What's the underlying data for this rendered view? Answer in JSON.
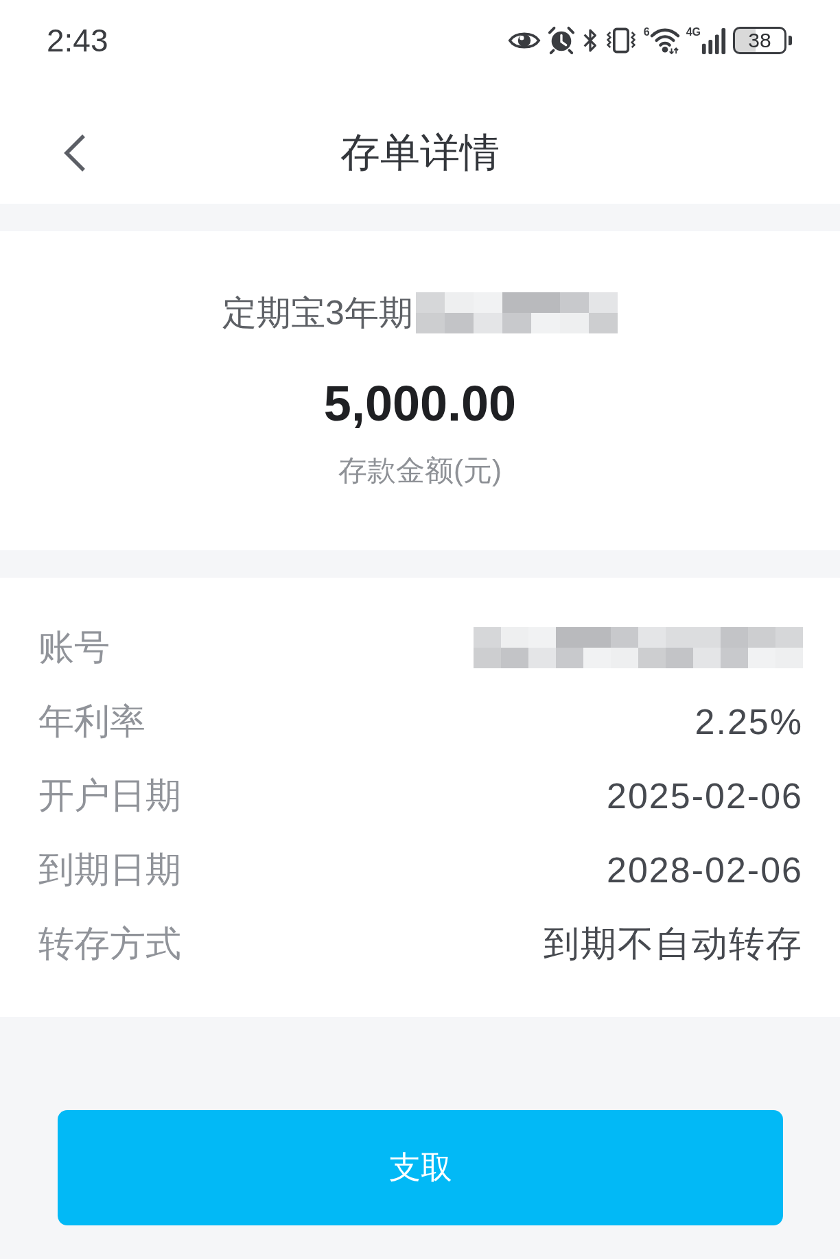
{
  "status_bar": {
    "time": "2:43",
    "wifi_generation": "6",
    "network_type": "4G",
    "battery": "38"
  },
  "header": {
    "title": "存单详情"
  },
  "summary": {
    "product_name": "定期宝3年期",
    "name_masked": true,
    "amount": "5,000.00",
    "amount_label": "存款金额(元)"
  },
  "details": [
    {
      "label": "账号",
      "kind": "masked"
    },
    {
      "label": "年利率",
      "kind": "text",
      "value": "2.25%"
    },
    {
      "label": "开户日期",
      "kind": "text",
      "value": "2025-02-06"
    },
    {
      "label": "到期日期",
      "kind": "text",
      "value": "2028-02-06"
    },
    {
      "label": "转存方式",
      "kind": "text",
      "value": "到期不自动转存"
    }
  ],
  "actions": {
    "withdraw": "支取"
  }
}
